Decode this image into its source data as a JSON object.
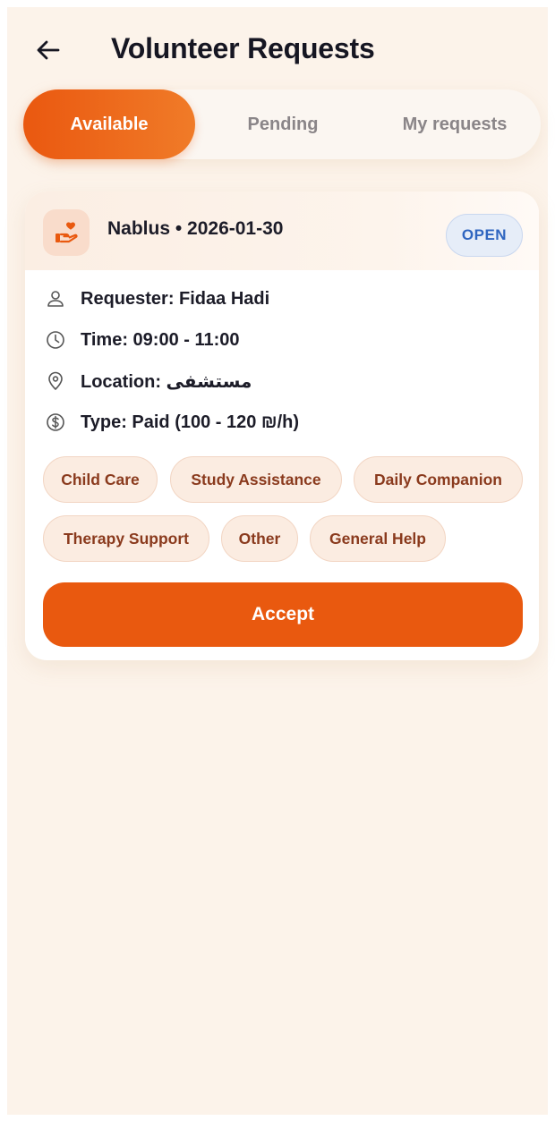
{
  "header": {
    "title": "Volunteer Requests"
  },
  "tabs": [
    {
      "label": "Available",
      "active": true
    },
    {
      "label": "Pending",
      "active": false
    },
    {
      "label": "My requests",
      "active": false
    }
  ],
  "request": {
    "title": "Nablus • 2026-01-30",
    "status": "OPEN",
    "requester": "Requester: Fidaa Hadi",
    "time": "Time: 09:00 - 11:00",
    "location": "Location: مستشفى",
    "type": "Type: Paid (100 - 120 ₪/h)",
    "tags": [
      "Child Care",
      "Study Assistance",
      "Daily Companion",
      "Therapy Support",
      "Other",
      "General Help"
    ],
    "accept_label": "Accept"
  },
  "colors": {
    "accent": "#e9590f",
    "background": "#fcf3ea",
    "status_open": "#2f65c0",
    "chip_text": "#8a3a1d"
  },
  "icons": {
    "back": "arrow-left-icon",
    "card": "hand-heart-icon",
    "requester": "user-icon",
    "time": "clock-icon",
    "location": "map-pin-icon",
    "type": "dollar-circle-icon"
  }
}
